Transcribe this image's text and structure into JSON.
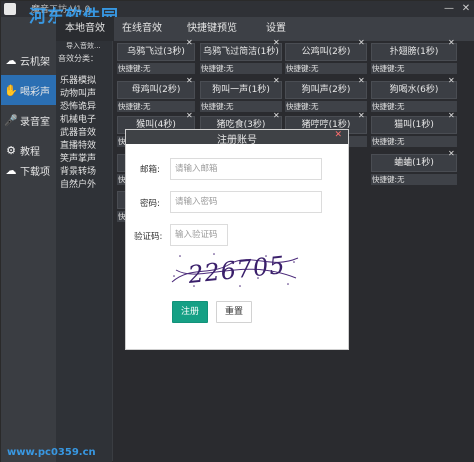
{
  "window": {
    "title": "魔音工坊 V1.0",
    "watermark": "河东软件园",
    "watermark_url": "www.pc0359.cn",
    "minimize_glyph": "—",
    "close_glyph": "✕"
  },
  "tabs": [
    {
      "label": "本地音效",
      "active": true
    },
    {
      "label": "在线音效",
      "active": false
    },
    {
      "label": "快捷键预览",
      "active": false
    },
    {
      "label": "设置",
      "active": false
    }
  ],
  "sidebar": {
    "items": [
      {
        "label": "云机架",
        "icon": "cloud-icon",
        "glyph": "☁",
        "active": false
      },
      {
        "label": "喝彩声",
        "icon": "clap-icon",
        "glyph": "✋",
        "active": true
      },
      {
        "label": "录音室",
        "icon": "microphone-icon",
        "glyph": "🎤",
        "active": false
      },
      {
        "label": "教程",
        "icon": "gear-icon",
        "glyph": "⚙",
        "active": false
      },
      {
        "label": "下载项",
        "icon": "cloud-download-icon",
        "glyph": "☁",
        "active": false
      }
    ]
  },
  "categories": {
    "search_placeholder": "导入音效...",
    "header": "音效分类：",
    "items": [
      "乐器模拟",
      "动物叫声",
      "恐怖诡异",
      "机械电子",
      "武器音效",
      "直播特效",
      "笑声掌声",
      "背景转场",
      "自然户外"
    ]
  },
  "sounds": {
    "close_glyph": "✕",
    "rows": [
      [
        {
          "name": "乌鸦飞过(3秒)",
          "key": "快捷键:无"
        },
        {
          "name": "乌鸦飞过简洁(1秒)",
          "key": "快捷键:无"
        },
        {
          "name": "公鸡叫(2秒)",
          "key": "快捷键:无"
        },
        {
          "name": "扑翅膀(1秒)",
          "key": "快捷键:无"
        }
      ],
      [
        {
          "name": "母鸡叫(2秒)",
          "key": "快捷键:无"
        },
        {
          "name": "狗叫一声(1秒)",
          "key": "快捷键:无"
        },
        {
          "name": "狗叫声(2秒)",
          "key": "快捷键:无"
        },
        {
          "name": "狗喝水(6秒)",
          "key": "快捷键:无"
        }
      ],
      [
        {
          "name": "猴叫(4秒)",
          "key": "快捷键:无"
        },
        {
          "name": "猪吃食(3秒)",
          "key": "快捷键:无"
        },
        {
          "name": "猪哼哼(1秒)",
          "key": "快捷键:无"
        },
        {
          "name": "猫叫(1秒)",
          "key": "快捷键:无"
        }
      ],
      [
        {
          "name": "绿",
          "key": "快"
        },
        {
          "name": "",
          "key": ""
        },
        {
          "name": "",
          "key": ""
        },
        {
          "name": "蛐蛐(1秒)",
          "key": "快捷键:无"
        }
      ],
      [
        {
          "name": "飞",
          "key": "快"
        },
        {
          "name": "",
          "key": ""
        },
        {
          "name": "",
          "key": ""
        },
        {
          "name": "",
          "key": ""
        }
      ]
    ]
  },
  "dialog": {
    "title": "注册账号",
    "close_glyph": "✕",
    "email_label": "邮箱:",
    "email_placeholder": "请输入邮箱",
    "password_label": "密码:",
    "password_placeholder": "请输入密码",
    "captcha_label": "验证码:",
    "captcha_placeholder": "输入验证码",
    "captcha_text": "226705",
    "register_label": "注册",
    "reset_label": "重置"
  }
}
